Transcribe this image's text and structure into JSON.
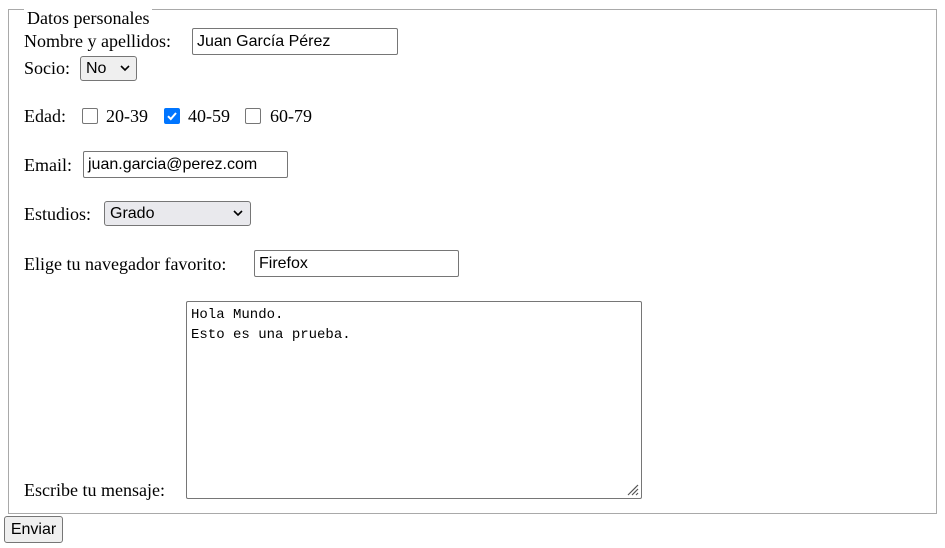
{
  "fieldset": {
    "legend": "Datos personales"
  },
  "nombre": {
    "label": "Nombre y apellidos:",
    "value": "Juan García Pérez"
  },
  "socio": {
    "label": "Socio:",
    "selected": "No"
  },
  "edad": {
    "label": "Edad:",
    "options": [
      {
        "label": "20-39",
        "checked": false
      },
      {
        "label": "40-59",
        "checked": true
      },
      {
        "label": "60-79",
        "checked": false
      }
    ]
  },
  "email": {
    "label": "Email:",
    "value": "juan.garcia@perez.com"
  },
  "estudios": {
    "label": "Estudios:",
    "selected": "Grado"
  },
  "navegador": {
    "label": "Elige tu navegador favorito:",
    "value": "Firefox"
  },
  "mensaje": {
    "label": "Escribe tu mensaje:",
    "lines": [
      "Hola Mundo.",
      "Esto es una prueba."
    ]
  },
  "submit": {
    "label": "Enviar"
  },
  "colors": {
    "checkbox_checked": "#0075ff",
    "border": "#767676",
    "fieldset_border": "#a9a9a9"
  }
}
